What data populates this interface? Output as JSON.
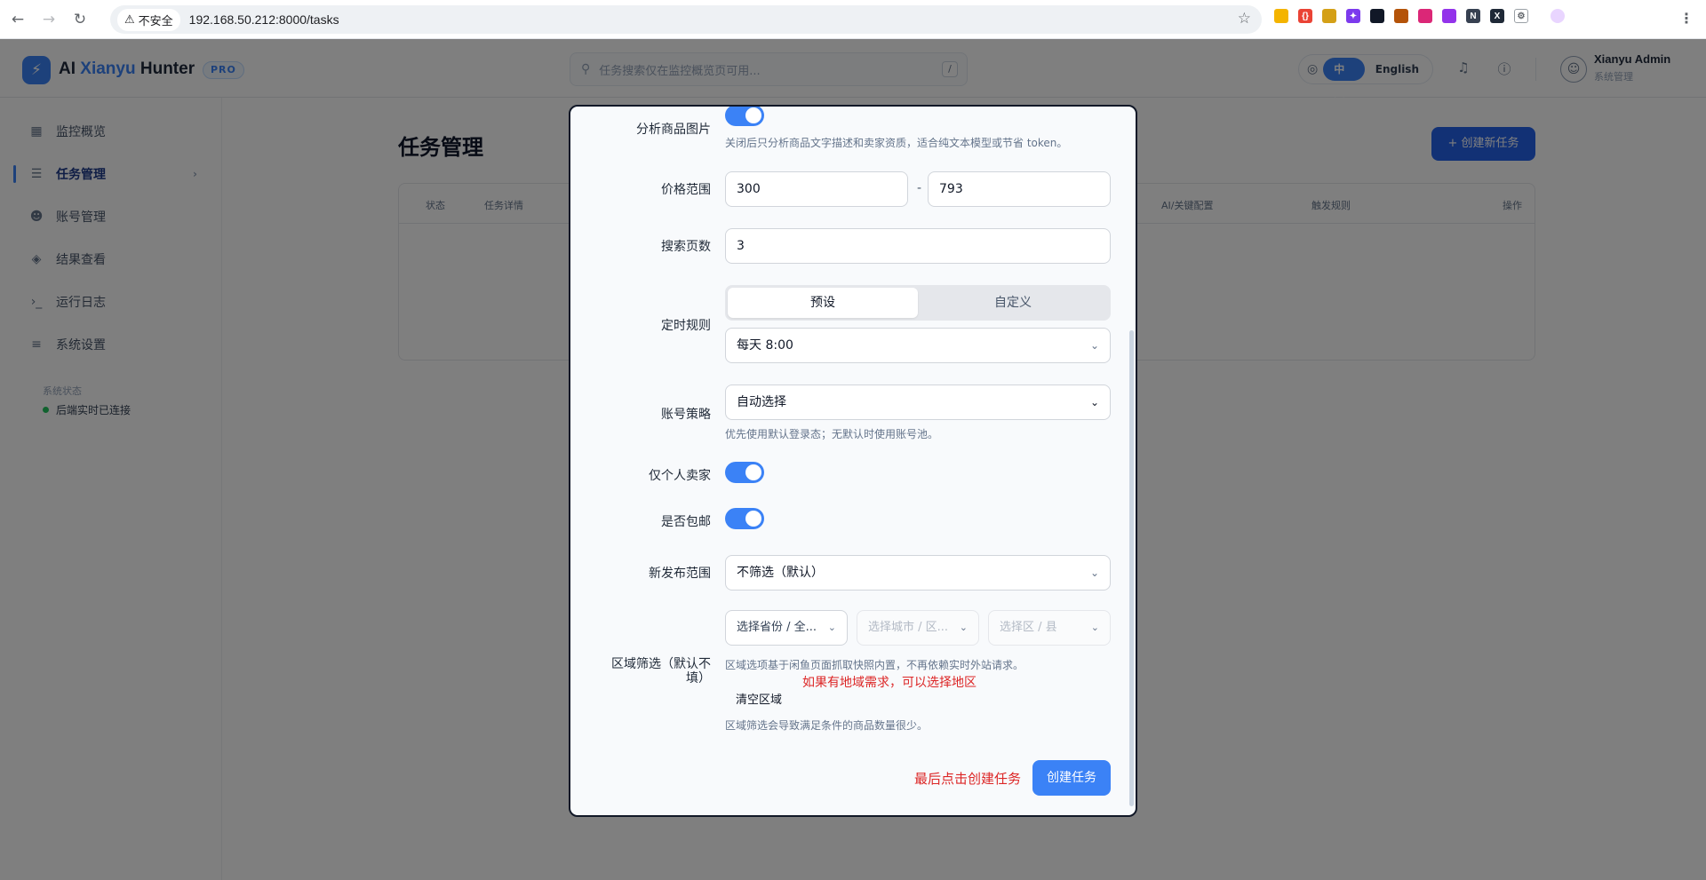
{
  "browser": {
    "security_label": "不安全",
    "url": "192.168.50.212:8000/tasks"
  },
  "header": {
    "brand_prefix": "AI ",
    "brand_accent": "Xianyu",
    "brand_suffix": " Hunter",
    "badge": "PRO",
    "search_placeholder": "任务搜索仅在监控概览页可用...",
    "search_shortcut": "/",
    "lang_options": [
      "中文",
      "English"
    ],
    "active_lang": "中文",
    "user_name": "Xianyu Admin",
    "user_role": "系统管理"
  },
  "sidebar": {
    "items": [
      {
        "label": "监控概览",
        "icon": "dashboard-icon"
      },
      {
        "label": "任务管理",
        "icon": "task-list-icon",
        "active": true
      },
      {
        "label": "账号管理",
        "icon": "users-icon"
      },
      {
        "label": "结果查看",
        "icon": "layers-icon"
      },
      {
        "label": "运行日志",
        "icon": "terminal-icon"
      },
      {
        "label": "系统设置",
        "icon": "sliders-icon"
      }
    ],
    "status_title": "系统状态",
    "status_text": "后端实时已连接"
  },
  "page": {
    "title": "任务管理",
    "create_button": "+ 创建新任务",
    "columns": [
      "状态",
      "任务详情",
      "AI/关键配置",
      "触发规则",
      "操作"
    ]
  },
  "modal": {
    "analyze_images_label": "分析商品图片",
    "analyze_images_hint": "关闭后只分析商品文字描述和卖家资质，适合纯文本模型或节省 token。",
    "analyze_images_on": true,
    "price_range_label": "价格范围",
    "price_min": "300",
    "price_sep": "-",
    "price_max": "793",
    "pages_label": "搜索页数",
    "pages_value": "3",
    "schedule_label": "定时规则",
    "schedule_modes": [
      "预设",
      "自定义"
    ],
    "schedule_mode_active": "预设",
    "schedule_value": "每天 8:00",
    "account_label": "账号策略",
    "account_value": "自动选择",
    "account_hint": "优先使用默认登录态；无默认时使用账号池。",
    "personal_only_label": "仅个人卖家",
    "personal_only_on": true,
    "free_shipping_label": "是否包邮",
    "free_shipping_on": true,
    "new_publish_label": "新发布范围",
    "new_publish_value": "不筛选（默认）",
    "region_label": "区域筛选（默认不填）",
    "province_placeholder": "选择省份 / 全...",
    "city_placeholder": "选择城市 / 区...",
    "district_placeholder": "选择区 / 县",
    "region_hint": "区域选项基于闲鱼页面抓取快照内置，不再依赖实时外站请求。",
    "region_note": "如果有地域需求，可以选择地区",
    "clear_region": "清空区域",
    "region_warning": "区域筛选会导致满足条件的商品数量很少。",
    "submit_note": "最后点击创建任务",
    "submit_button": "创建任务"
  },
  "colors": {
    "accent": "#3b82f6",
    "annotation_red": "#dc2626",
    "overlay": "rgba(0,0,0,0.5)"
  }
}
